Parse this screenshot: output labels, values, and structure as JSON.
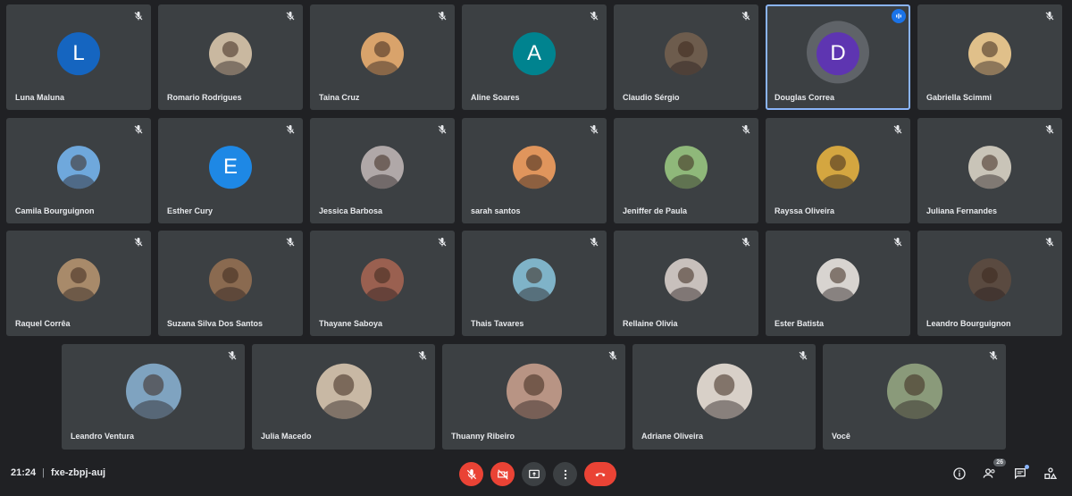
{
  "participants_row1": [
    {
      "name": "Luna Maluna",
      "avatar": "letter",
      "letter": "L",
      "color": "#1565c0"
    },
    {
      "name": "Romario Rodrigues",
      "avatar": "photo",
      "color": "#c9b8a0"
    },
    {
      "name": "Taina Cruz",
      "avatar": "photo",
      "color": "#d9a36b"
    },
    {
      "name": "Aline Soares",
      "avatar": "letter",
      "letter": "A",
      "color": "#00838f"
    },
    {
      "name": "Claudio Sérgio",
      "avatar": "photo",
      "color": "#6d5c4d"
    },
    {
      "name": "Douglas Correa",
      "avatar": "letter",
      "letter": "D",
      "color": "#5e35b1",
      "active": true
    },
    {
      "name": "Gabriella Scimmi",
      "avatar": "photo",
      "color": "#e0c08a"
    }
  ],
  "participants_row2": [
    {
      "name": "Camila Bourguignon",
      "avatar": "photo",
      "color": "#6fa8dc"
    },
    {
      "name": "Esther Cury",
      "avatar": "letter",
      "letter": "E",
      "color": "#1e88e5"
    },
    {
      "name": "Jessica Barbosa",
      "avatar": "photo",
      "color": "#b0a8a8"
    },
    {
      "name": "sarah santos",
      "avatar": "photo",
      "color": "#e0955c"
    },
    {
      "name": "Jeniffer de Paula",
      "avatar": "photo",
      "color": "#8fb87a"
    },
    {
      "name": "Rayssa Oliveira",
      "avatar": "photo",
      "color": "#d4a640"
    },
    {
      "name": "Juliana Fernandes",
      "avatar": "photo",
      "color": "#c9c4b8"
    }
  ],
  "participants_row3": [
    {
      "name": "Raquel Corrêa",
      "avatar": "photo",
      "color": "#a88a6a"
    },
    {
      "name": "Suzana Silva Dos Santos",
      "avatar": "photo",
      "color": "#8a6a50"
    },
    {
      "name": "Thayane Saboya",
      "avatar": "photo",
      "color": "#9a6050"
    },
    {
      "name": "Thais Tavares",
      "avatar": "photo",
      "color": "#7fb3c8"
    },
    {
      "name": "Rellaine Olivia",
      "avatar": "photo",
      "color": "#c8c0bc"
    },
    {
      "name": "Ester Batista",
      "avatar": "photo",
      "color": "#d8d4d0"
    },
    {
      "name": "Leandro Bourguignon",
      "avatar": "photo",
      "color": "#5a4a40"
    }
  ],
  "participants_row4": [
    {
      "name": "Leandro Ventura",
      "avatar": "photo",
      "color": "#7fa3c0"
    },
    {
      "name": "Julia Macedo",
      "avatar": "photo",
      "color": "#c8b8a4"
    },
    {
      "name": "Thuanny Ribeiro",
      "avatar": "photo",
      "color": "#b89484"
    },
    {
      "name": "Adriane Oliveira",
      "avatar": "photo",
      "color": "#d8d0c8"
    },
    {
      "name": "Você",
      "avatar": "photo",
      "color": "#8a9a7a"
    }
  ],
  "meeting": {
    "time": "21:24",
    "separator": "|",
    "code": "fxe-zbpj-auj"
  },
  "controls": [
    "mic-off",
    "camera-off",
    "present-screen",
    "more-options",
    "leave-call"
  ],
  "right_controls": {
    "people_count": "26"
  },
  "colors": {
    "background": "#202124",
    "tile": "#3c4043",
    "danger": "#ea4335",
    "accent": "#8ab4f8"
  }
}
